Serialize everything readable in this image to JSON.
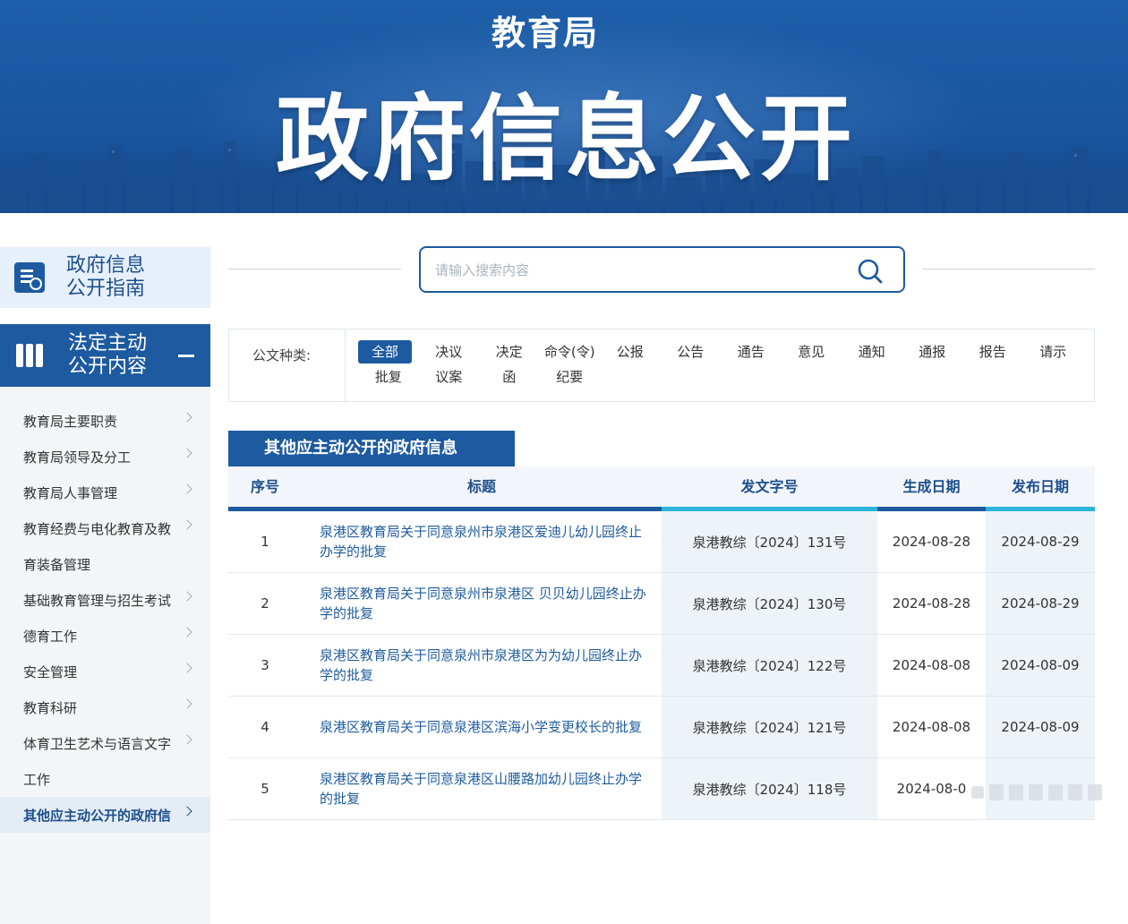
{
  "banner": {
    "org": "教育局",
    "title": "政府信息公开"
  },
  "sidebar": {
    "guide_label": "政府信息\n公开指南",
    "legal_label": "法定主动\n公开内容",
    "items": [
      {
        "label": "教育局主要职责"
      },
      {
        "label": "教育局领导及分工"
      },
      {
        "label": "教育局人事管理"
      },
      {
        "label": "教育经费与电化教育及教"
      },
      {
        "label": "育装备管理"
      },
      {
        "label": "基础教育管理与招生考试"
      },
      {
        "label": "德育工作"
      },
      {
        "label": "安全管理"
      },
      {
        "label": "教育科研"
      },
      {
        "label": "体育卫生艺术与语言文字"
      },
      {
        "label": "工作"
      },
      {
        "label": "其他应主动公开的政府信"
      }
    ]
  },
  "search": {
    "placeholder": "请输入搜索内容"
  },
  "filter": {
    "label": "公文种类:",
    "options": [
      "全部",
      "决议",
      "决定",
      "命令(令)",
      "公报",
      "公告",
      "通告",
      "意见",
      "通知",
      "通报",
      "报告",
      "请示",
      "批复",
      "议案",
      "函",
      "纪要"
    ],
    "active": "全部"
  },
  "section_title": "其他应主动公开的政府信息",
  "table": {
    "headers": [
      "序号",
      "标题",
      "发文字号",
      "生成日期",
      "发布日期"
    ],
    "rows": [
      {
        "no": "1",
        "title": "泉港区教育局关于同意泉州市泉港区爱迪儿幼儿园终止办学的批复",
        "doc_no": "泉港教综〔2024〕131号",
        "created": "2024-08-28",
        "published": "2024-08-29"
      },
      {
        "no": "2",
        "title": "泉港区教育局关于同意泉州市泉港区 贝贝幼儿园终止办学的批复",
        "doc_no": "泉港教综〔2024〕130号",
        "created": "2024-08-28",
        "published": "2024-08-29"
      },
      {
        "no": "3",
        "title": "泉港区教育局关于同意泉州市泉港区为为幼儿园终止办学的批复",
        "doc_no": "泉港教综〔2024〕122号",
        "created": "2024-08-08",
        "published": "2024-08-09"
      },
      {
        "no": "4",
        "title": "泉港区教育局关于同意泉港区滨海小学变更校长的批复",
        "doc_no": "泉港教综〔2024〕121号",
        "created": "2024-08-08",
        "published": "2024-08-09"
      },
      {
        "no": "5",
        "title": "泉港区教育局关于同意泉港区山腰路加幼儿园终止办学的批复",
        "doc_no": "泉港教综〔2024〕118号",
        "created": "2024-08-0",
        "published": ""
      }
    ]
  },
  "colors": {
    "primary": "#1d5aa0",
    "accent": "#2cb4d8",
    "link": "#1f5c9e"
  }
}
